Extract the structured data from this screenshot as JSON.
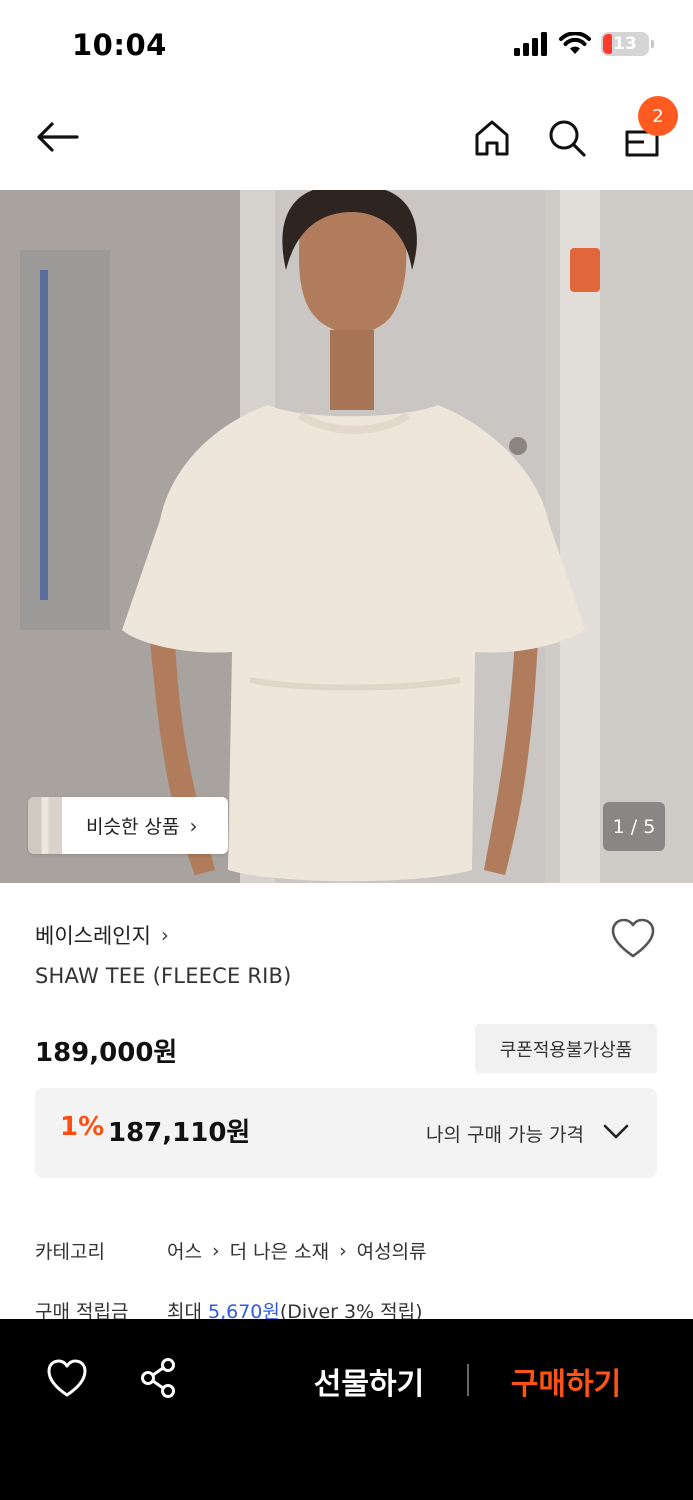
{
  "status_bar": {
    "time": "10:04",
    "battery": "13"
  },
  "nav": {
    "cart_count": "2"
  },
  "gallery": {
    "similar_label": "비슷한 상품",
    "page_indicator": "1 / 5"
  },
  "product": {
    "brand": "베이스레인지",
    "name": "SHAW TEE (FLEECE RIB)",
    "price": "189,000원",
    "coupon_tag": "쿠폰적용불가상품",
    "my_price": {
      "discount": "1%",
      "price": "187,110원",
      "label": "나의 구매 가능 가격"
    }
  },
  "info": {
    "category_key": "카테고리",
    "category_path": [
      "어스",
      "더 나은 소재",
      "여성의류"
    ],
    "points_key": "구매 적립금",
    "points_prefix": "최대 ",
    "points_amount": "5,670원",
    "points_suffix": "(Diver 3% 적립)"
  },
  "bottom_bar": {
    "gift_label": "선물하기",
    "buy_label": "구매하기"
  },
  "colors": {
    "accent": "#ff5316",
    "badge": "#ff5a1f",
    "link": "#2d5be3"
  },
  "icons": [
    "back-arrow-icon",
    "home-icon",
    "search-icon",
    "bag-icon",
    "heart-icon",
    "share-icon",
    "chevron-down-icon"
  ]
}
